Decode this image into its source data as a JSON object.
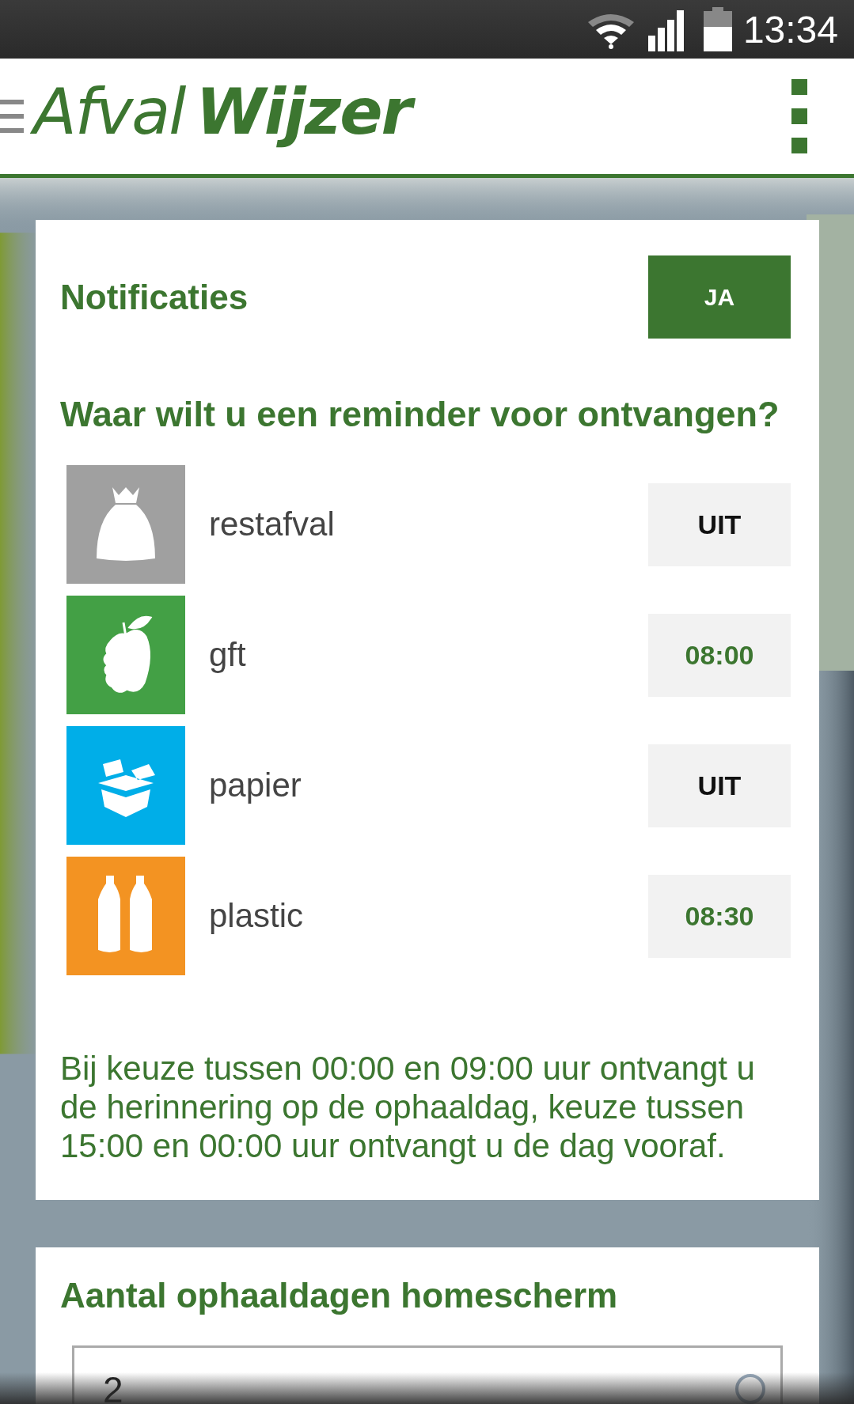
{
  "status_bar": {
    "time": "13:34"
  },
  "header": {
    "logo": {
      "part_1": "Afval",
      "part_2": "Wijzer"
    }
  },
  "notifications": {
    "title": "Notificaties",
    "toggle": {
      "label": "JA",
      "on": true
    },
    "question": "Waar wilt u een reminder voor ontvangen?",
    "items": [
      {
        "kind": "restafval",
        "name": "restafval",
        "reminder": "UIT",
        "on": false
      },
      {
        "kind": "gft",
        "name": "gft",
        "reminder": "08:00",
        "on": true
      },
      {
        "kind": "papier",
        "name": "papier",
        "reminder": "UIT",
        "on": false
      },
      {
        "kind": "plastic",
        "name": "plastic",
        "reminder": "08:30",
        "on": true
      }
    ],
    "note": "Bij keuze tussen 00:00 en 09:00 uur ontvangt u de herinnering op de ophaaldag, keuze tussen 15:00 en 00:00 uur ontvangt u de dag vooraf."
  },
  "homescreen": {
    "title": "Aantal ophaaldagen homescherm",
    "select": {
      "value": "2"
    }
  }
}
